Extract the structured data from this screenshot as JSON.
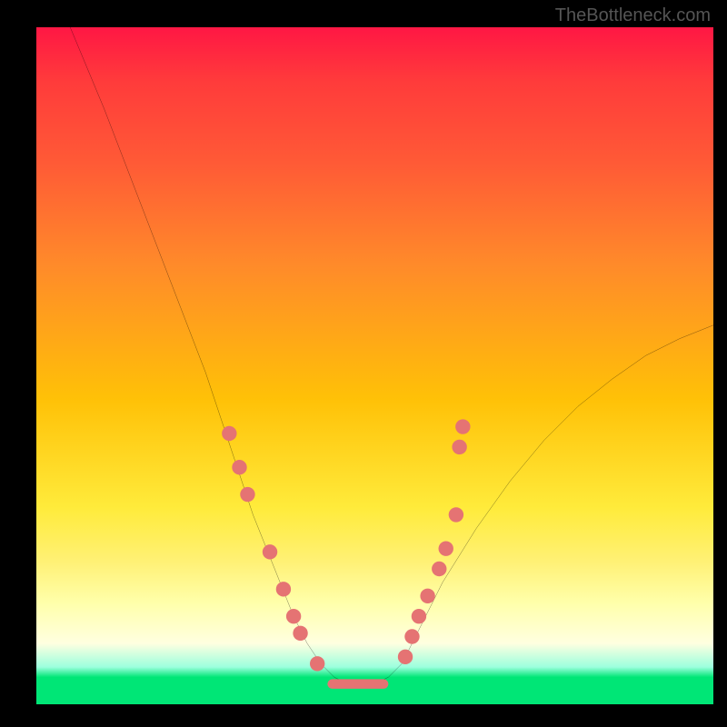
{
  "watermark": "TheBottleneck.com",
  "chart_data": {
    "type": "line",
    "title": "",
    "xlabel": "",
    "ylabel": "",
    "xlim": [
      0,
      100
    ],
    "ylim": [
      0,
      100
    ],
    "series": [
      {
        "name": "curve",
        "x": [
          5,
          10,
          15,
          20,
          25,
          28,
          30,
          32,
          34,
          36,
          38,
          40,
          42,
          44,
          46,
          48,
          50,
          52,
          54,
          56,
          60,
          65,
          70,
          75,
          80,
          85,
          90,
          95,
          100
        ],
        "y": [
          100,
          88,
          75,
          62,
          49,
          40,
          34,
          28,
          23,
          18,
          13,
          9,
          6,
          4,
          3,
          3,
          3,
          4,
          6,
          10,
          18,
          26,
          33,
          39,
          44,
          48,
          51.5,
          54,
          56
        ]
      }
    ],
    "markers_left": [
      {
        "x": 28.5,
        "y": 40
      },
      {
        "x": 30,
        "y": 35
      },
      {
        "x": 31.2,
        "y": 31
      },
      {
        "x": 34.5,
        "y": 22.5
      },
      {
        "x": 36.5,
        "y": 17
      },
      {
        "x": 38,
        "y": 13
      },
      {
        "x": 39,
        "y": 10.5
      },
      {
        "x": 41.5,
        "y": 6
      }
    ],
    "markers_right": [
      {
        "x": 54.5,
        "y": 7
      },
      {
        "x": 55.5,
        "y": 10
      },
      {
        "x": 56.5,
        "y": 13
      },
      {
        "x": 57.8,
        "y": 16
      },
      {
        "x": 59.5,
        "y": 20
      },
      {
        "x": 60.5,
        "y": 23
      },
      {
        "x": 62,
        "y": 28
      },
      {
        "x": 62.5,
        "y": 38
      },
      {
        "x": 63,
        "y": 41
      }
    ],
    "bottom_bar": {
      "x_start": 43,
      "x_end": 52,
      "y": 3
    }
  }
}
